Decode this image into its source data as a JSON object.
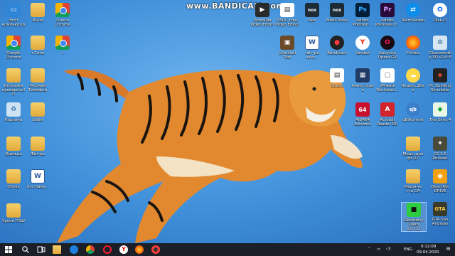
{
  "watermark": "www.BANDICAM.com",
  "icons": {
    "this_pc": "Этот компьютер",
    "inna": "Инна",
    "olesya_chrome": "Олеся Chrome",
    "google_chrome": "Google Chrome",
    "tanya": "т.Таня",
    "i": "i",
    "kollazhi": "Коллажи проверить!!!",
    "russkiy": "Русский Тимофей",
    "korzina": "Корзина",
    "babi": "Баби",
    "odezhda": "Одежда",
    "fiz_ra": "Физ-ра",
    "obuv": "Обувь",
    "doc": "doc-Заяв...",
    "uroki": "Уроки РЭШ",
    "videopad": "VideoPad Video Editor",
    "vsdc": "VSDC Free Video Editor",
    "nox": "Nox",
    "multidrive": "Multi-Drive",
    "photoshop": "Adobe Photosh...",
    "premiere": "Adobe Premiere P...",
    "teamviewer": "TeamViewer",
    "disko": "Disk-O",
    "uninstall": "Uninstall Tool",
    "lit_ra": "лит-ра вне...",
    "bandicam": "Bandicam",
    "yandex": "Yandex",
    "opera": "Браузер Opera GX",
    "firefox": "Firefox",
    "disassembly": "Disassembly 3D v2.6.5",
    "studio": "Studio",
    "kinostudio": "Киностудия",
    "vmware": "VMware Workstati...",
    "yandex_disk": "Яндекс.Диск",
    "pcbuilding": "PC Building Simulator",
    "aida": "AIDA64 Extreme",
    "acrobat": "Acrobat Reader DC",
    "qbittorrent": "qBittorrent",
    "sims4": "The Sims 4",
    "mody": "Моды для фс 17",
    "cs16": "CS 1.6 Russian",
    "mashiny": "Машины гта СА",
    "beamng": "BeamNG DRIVE",
    "geometry": "Geometry Dash v2.112",
    "gta": "GTA San Andreas"
  },
  "taskbar": {
    "lang": "ENG",
    "time": "0:12:09",
    "date": "09.04.2020"
  }
}
